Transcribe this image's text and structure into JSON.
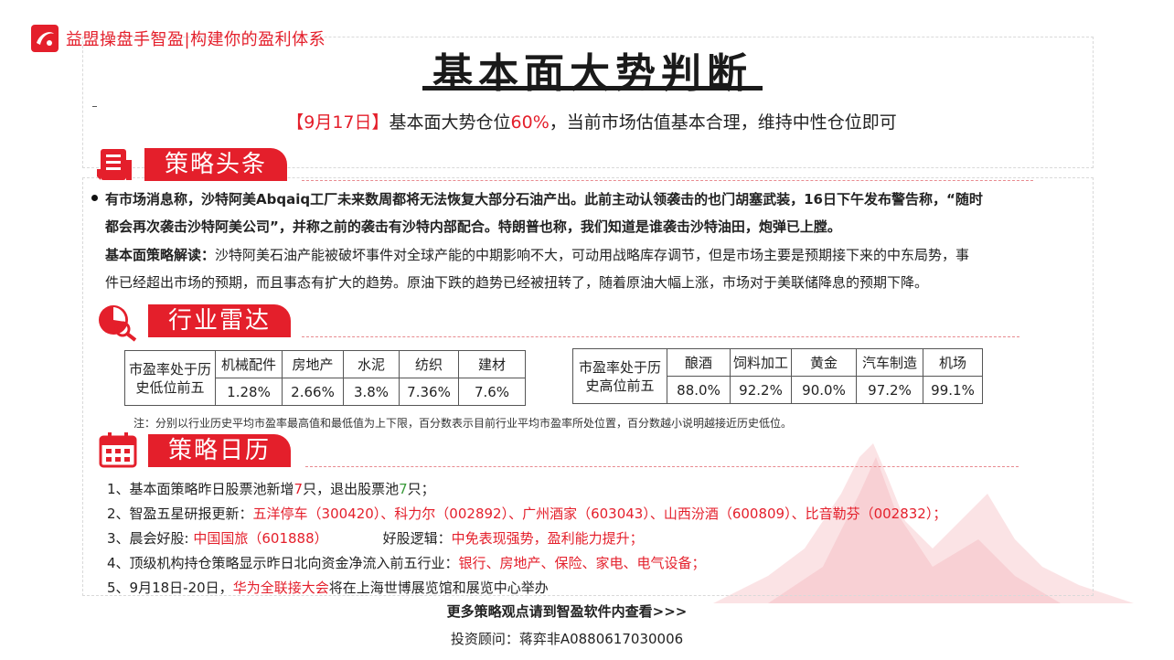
{
  "brand": {
    "name": "益盟操盘手智盈",
    "sep": "|",
    "slogan": "构建你的盈利体系"
  },
  "title": "基本面大势判断",
  "headline": {
    "date": "【9月17日】",
    "pre": "基本面大势仓位",
    "pct": "60%",
    "post": "，当前市场估值基本合理，维持中性仓位即可"
  },
  "sections": {
    "strategy": "策略头条",
    "radar": "行业雷达",
    "calendar": "策略日历"
  },
  "news": {
    "line1": "有市场消息称，沙特阿美Abqaiq工厂未来数周都将无法恢复大部分石油产出。此前主动认领袭击的也门胡塞武装，16日下午发布警告称，“随时",
    "line2": "都会再次袭击沙特阿美公司”，并称之前的袭击有沙特内部配合。特朗普也称，我们知道是谁袭击沙特油田，炮弹已上膛。",
    "analysis_label": "基本面策略解读：",
    "analysis_line1": "沙特阿美石油产能被破坏事件对全球产能的中期影响不大，可动用战略库存调节，但是市场主要是预期接下来的中东局势，事",
    "analysis_line2": "件已经超出市场的预期，而且事态有扩大的趋势。原油下跌的趋势已经被扭转了，随着原油大幅上涨，市场对于美联储降息的预期下降。"
  },
  "low_table": {
    "head_line1": "市盈率处于历",
    "head_line2": "史低位前五",
    "industries": [
      "机械配件",
      "房地产",
      "水泥",
      "纺织",
      "建材"
    ],
    "values": [
      "1.28%",
      "2.66%",
      "3.8%",
      "7.36%",
      "7.6%"
    ]
  },
  "high_table": {
    "head_line1": "市盈率处于历",
    "head_line2": "史高位前五",
    "industries": [
      "酿酒",
      "饲料加工",
      "黄金",
      "汽车制造",
      "机场"
    ],
    "values": [
      "88.0%",
      "92.2%",
      "90.0%",
      "97.2%",
      "99.1%"
    ]
  },
  "note": "注：分别以行业历史平均市盈率最高值和最低值为上下限，百分数表示目前行业平均市盈率所处位置，百分数越小说明越接近历史低位。",
  "calendar": {
    "i1_a": "1、基本面策略昨日股票池新增",
    "i1_n1": "7",
    "i1_b": "只，退出股票池",
    "i1_n2": "7",
    "i1_c": "只；",
    "i2_label": "2、智盈五星研报更新：",
    "i2_stocks": "五洋停车（300420）、科力尔（002892）、广州酒家（603043）、山西汾酒（600809）、比音勒芬（002832）；",
    "i3_label": "3、晨会好股: ",
    "i3_stock": "中国国旅（601888）",
    "i3_logic_label": "好股逻辑：",
    "i3_logic": "中免表现强势，盈利能力提升；",
    "i4_label": "4、顶级机构持仓策略显示昨日北向资金净流入前五行业：",
    "i4_inds": "银行、房地产、保险、家电、电气设备；",
    "i5_a": "5、9月18日-20日，",
    "i5_event": "华为全联接大会",
    "i5_b": "将在上海世博展览馆和展览中心举办"
  },
  "footer": {
    "more": "更多策略观点请到智盈软件内查看>>>",
    "advisor": "投资顾问：蒋弈非A0880617030006"
  },
  "colors": {
    "accent": "#e41f2b",
    "positive": "#3a9a3a"
  }
}
